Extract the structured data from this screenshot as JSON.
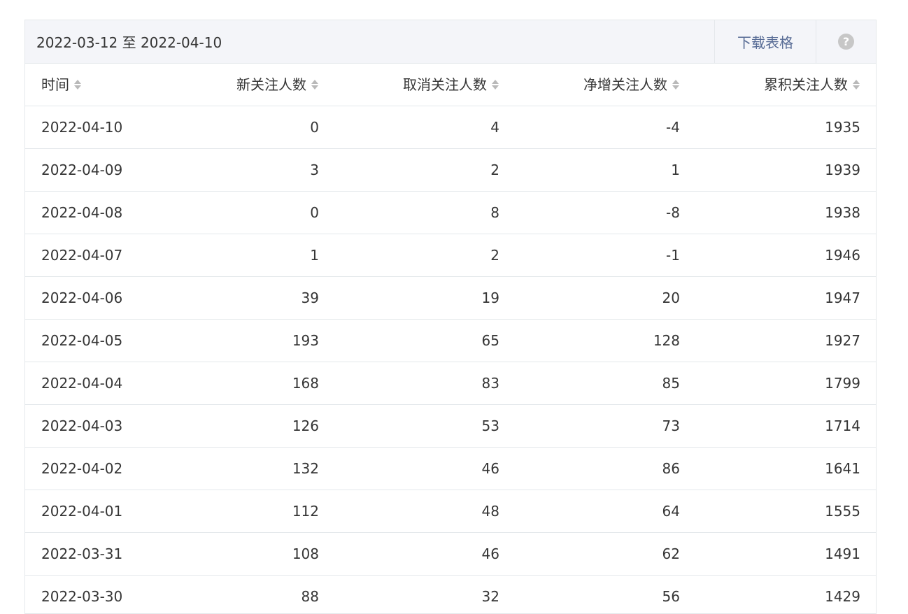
{
  "toolbar": {
    "date_range": "2022-03-12 至 2022-04-10",
    "download_label": "下载表格",
    "help_label": "?"
  },
  "table": {
    "headers": [
      "时间",
      "新关注人数",
      "取消关注人数",
      "净增关注人数",
      "累积关注人数"
    ],
    "rows": [
      [
        "2022-04-10",
        "0",
        "4",
        "-4",
        "1935"
      ],
      [
        "2022-04-09",
        "3",
        "2",
        "1",
        "1939"
      ],
      [
        "2022-04-08",
        "0",
        "8",
        "-8",
        "1938"
      ],
      [
        "2022-04-07",
        "1",
        "2",
        "-1",
        "1946"
      ],
      [
        "2022-04-06",
        "39",
        "19",
        "20",
        "1947"
      ],
      [
        "2022-04-05",
        "193",
        "65",
        "128",
        "1927"
      ],
      [
        "2022-04-04",
        "168",
        "83",
        "85",
        "1799"
      ],
      [
        "2022-04-03",
        "126",
        "53",
        "73",
        "1714"
      ],
      [
        "2022-04-02",
        "132",
        "46",
        "86",
        "1641"
      ],
      [
        "2022-04-01",
        "112",
        "48",
        "64",
        "1555"
      ],
      [
        "2022-03-31",
        "108",
        "46",
        "62",
        "1491"
      ],
      [
        "2022-03-30",
        "88",
        "32",
        "56",
        "1429"
      ]
    ]
  },
  "colors": {
    "link": "#576b95",
    "toolbar_bg": "#f4f5f9",
    "border": "#e4e8eb",
    "sort_icon": "#b9b9b9"
  }
}
